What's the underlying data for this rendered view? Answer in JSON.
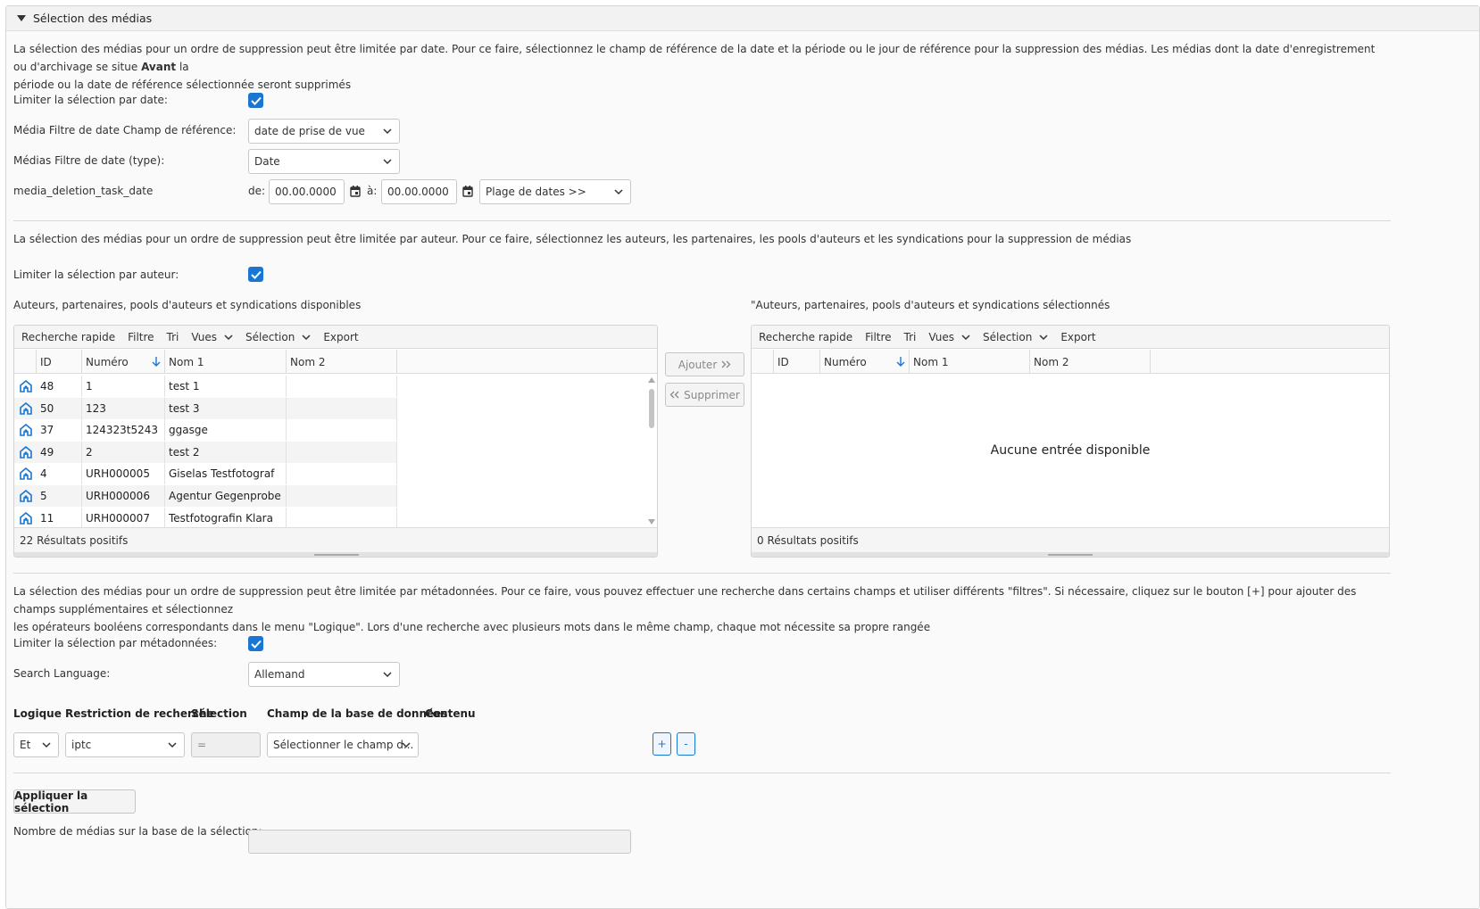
{
  "panel": {
    "title": "Sélection des médias"
  },
  "date_section": {
    "intro_pre": "La sélection des médias pour un ordre de suppression peut être limitée par date. Pour ce faire, sélectionnez le champ de référence de la date et la période ou le jour de référence pour la suppression des médias. Les médias dont la date d'enregistrement ou d'archivage se situe ",
    "intro_bold": "Avant",
    "intro_post": " la",
    "intro_line2": "période ou la date de référence sélectionnée seront supprimés",
    "limit_label": "Limiter la sélection par date:",
    "ref_field_label": "Média Filtre de date Champ de référence:",
    "ref_field_value": "date de prise de vue",
    "type_label": "Médias Filtre de date (type):",
    "type_value": "Date",
    "task_date_label": "media_deletion_task_date",
    "from_label": "de:",
    "from_value": "00.00.0000",
    "to_label": "à:",
    "to_value": "00.00.0000",
    "range_value": "Plage de dates >>"
  },
  "author_section": {
    "intro": "La sélection des médias pour un ordre de suppression peut être limitée par auteur. Pour ce faire, sélectionnez les auteurs, les partenaires, les pools d'auteurs et les syndications pour la suppression de médias",
    "limit_label": "Limiter la sélection par auteur:",
    "available_title": "Auteurs, partenaires, pools d'auteurs et syndications disponibles",
    "selected_title": "\"Auteurs, partenaires, pools d'auteurs et syndications sélectionnés",
    "toolbar": {
      "quick_search": "Recherche rapide",
      "filter": "Filtre",
      "sort": "Tri",
      "views": "Vues",
      "selection": "Sélection",
      "export": "Export"
    },
    "columns": {
      "id": "ID",
      "number": "Numéro",
      "name1": "Nom 1",
      "name2": "Nom 2"
    },
    "available_rows": [
      {
        "id": "48",
        "number": "1",
        "name1": "test 1",
        "name2": ""
      },
      {
        "id": "50",
        "number": "123",
        "name1": "test 3",
        "name2": ""
      },
      {
        "id": "37",
        "number": "124323t5243",
        "name1": "ggasge",
        "name2": ""
      },
      {
        "id": "49",
        "number": "2",
        "name1": "test 2",
        "name2": ""
      },
      {
        "id": "4",
        "number": "URH000005",
        "name1": "Giselas Testfotograf",
        "name2": ""
      },
      {
        "id": "5",
        "number": "URH000006",
        "name1": "Agentur Gegenprobe",
        "name2": ""
      },
      {
        "id": "11",
        "number": "URH000007",
        "name1": "Testfotografin Klara",
        "name2": ""
      }
    ],
    "available_count": "22 Résultats positifs",
    "selected_count": "0 Résultats positifs",
    "empty_text": "Aucune entrée disponible",
    "add_button": "Ajouter",
    "remove_button": "Supprimer"
  },
  "metadata_section": {
    "intro_line1": "La sélection des médias pour un ordre de suppression peut être limitée par métadonnées. Pour ce faire, vous pouvez effectuer une recherche dans certains champs et utiliser différents \"filtres\". Si nécessaire, cliquez sur le bouton [+] pour ajouter des champs supplémentaires et sélectionnez",
    "intro_line2": "les opérateurs booléens correspondants dans le menu \"Logique\". Lors d'une recherche avec plusieurs mots dans le même champ, chaque mot nécessite sa propre rangée",
    "limit_label": "Limiter la sélection par métadonnées:",
    "language_label": "Search Language:",
    "language_value": "Allemand",
    "headers": {
      "logic": "Logique",
      "restriction": "Restriction de recherche",
      "selection": "Sélection",
      "db_field": "Champ de la base de données",
      "content": "Contenu"
    },
    "row": {
      "logic": "Et",
      "restriction": "iptc",
      "selection": "=",
      "db_field": "Sélectionner le champ d...",
      "plus": "+",
      "minus": "-"
    }
  },
  "apply_button": "Appliquer la sélection",
  "count_label": "Nombre de médias sur la base de la sélection:",
  "colors": {
    "accent": "#1976d2"
  }
}
